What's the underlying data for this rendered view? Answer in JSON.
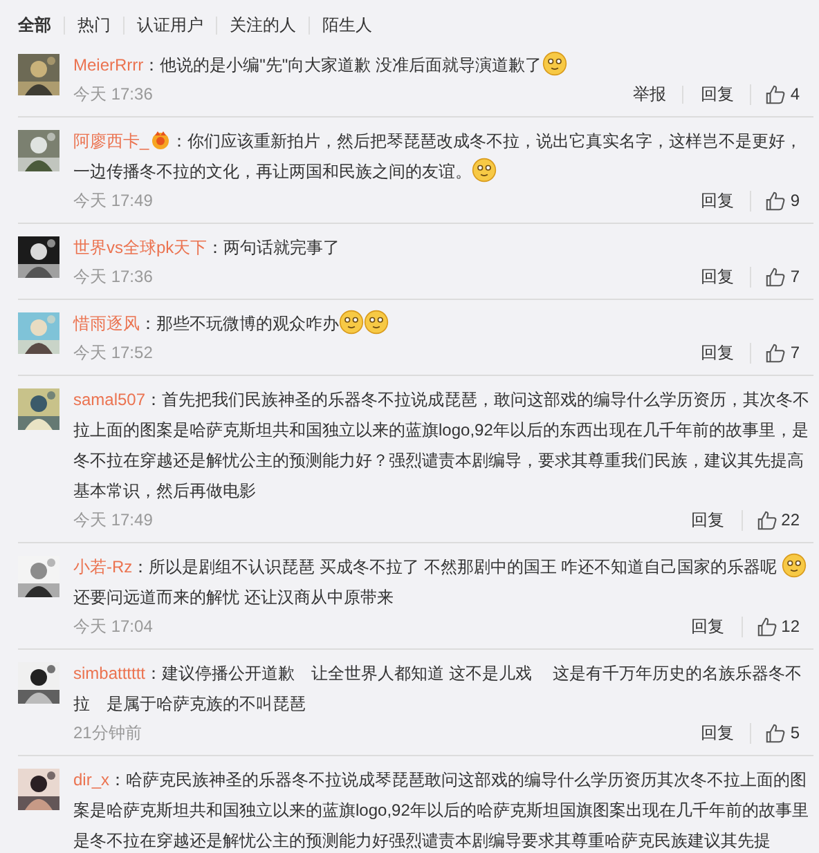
{
  "tabs": [
    {
      "label": "全部",
      "selected": true
    },
    {
      "label": "热门",
      "selected": false
    },
    {
      "label": "认证用户",
      "selected": false
    },
    {
      "label": "关注的人",
      "selected": false
    },
    {
      "label": "陌生人",
      "selected": false
    }
  ],
  "comments": [
    {
      "user": "MeierRrrr",
      "badge": false,
      "content": [
        {
          "kind": "text",
          "text": "：他说的是小编\"先\"向大家道歉 没准后面就导演道歉了"
        },
        {
          "kind": "emoji"
        }
      ],
      "time": "今天 17:36",
      "report": "举报",
      "reply": "回复",
      "likes": "4"
    },
    {
      "user": "阿廖西卡_",
      "badge": true,
      "content": [
        {
          "kind": "text",
          "text": "：你们应该重新拍片，然后把琴琵琶改成冬不拉，说出它真实名字，这样岂不是更好，一边传播冬不拉的文化，再让两国和民族之间的友谊。"
        },
        {
          "kind": "emoji"
        }
      ],
      "time": "今天 17:49",
      "reply": "回复",
      "likes": "9"
    },
    {
      "user": "世界vs全球pk天下",
      "badge": false,
      "content": [
        {
          "kind": "text",
          "text": "：两句话就完事了"
        }
      ],
      "time": "今天 17:36",
      "reply": "回复",
      "likes": "7"
    },
    {
      "user": "惜雨逐风",
      "badge": false,
      "content": [
        {
          "kind": "text",
          "text": "：那些不玩微博的观众咋办"
        },
        {
          "kind": "emoji"
        },
        {
          "kind": "emoji"
        }
      ],
      "time": "今天 17:52",
      "reply": "回复",
      "likes": "7"
    },
    {
      "user": "samal507",
      "badge": false,
      "content": [
        {
          "kind": "text",
          "text": "：首先把我们民族神圣的乐器冬不拉说成琵琶，敢问这部戏的编导什么学历资历，其次冬不拉上面的图案是哈萨克斯坦共和国独立以来的蓝旗logo,92年以后的东西出现在几千年前的故事里，是冬不拉在穿越还是解忧公主的预测能力好？强烈谴责本剧编导，要求其尊重我们民族，建议其先提高基本常识，然后再做电影"
        }
      ],
      "time": "今天 17:49",
      "reply": "回复",
      "likes": "22"
    },
    {
      "user": "小若-Rz",
      "badge": false,
      "content": [
        {
          "kind": "text",
          "text": "：所以是剧组不认识琵琶 买成冬不拉了 不然那剧中的国王 咋还不知道自己国家的乐器呢 "
        },
        {
          "kind": "emoji"
        },
        {
          "kind": "text",
          "text": " 还要问远道而来的解忧 还让汉商从中原带来"
        }
      ],
      "time": "今天 17:04",
      "reply": "回复",
      "likes": "12"
    },
    {
      "user": "simbatttttt",
      "badge": false,
      "content": [
        {
          "kind": "text",
          "text": "：建议停播公开道歉　让全世界人都知道 这不是儿戏　 这是有千万年历史的名族乐器冬不拉　是属于哈萨克族的不叫琵琶"
        }
      ],
      "time": "21分钟前",
      "reply": "回复",
      "likes": "5"
    },
    {
      "user": "dir_x",
      "badge": false,
      "content": [
        {
          "kind": "text",
          "text": "：哈萨克民族神圣的乐器冬不拉说成琴琵琶敢问这部戏的编导什么学历资历其次冬不拉上面的图案是哈萨克斯坦共和国独立以来的蓝旗logo,92年以后的哈萨克斯坦国旗图案出现在几千年前的故事里是冬不拉在穿越还是解忧公主的预测能力好强烈谴责本剧编导要求其尊重哈萨克民族建议其先提"
        }
      ]
    }
  ]
}
